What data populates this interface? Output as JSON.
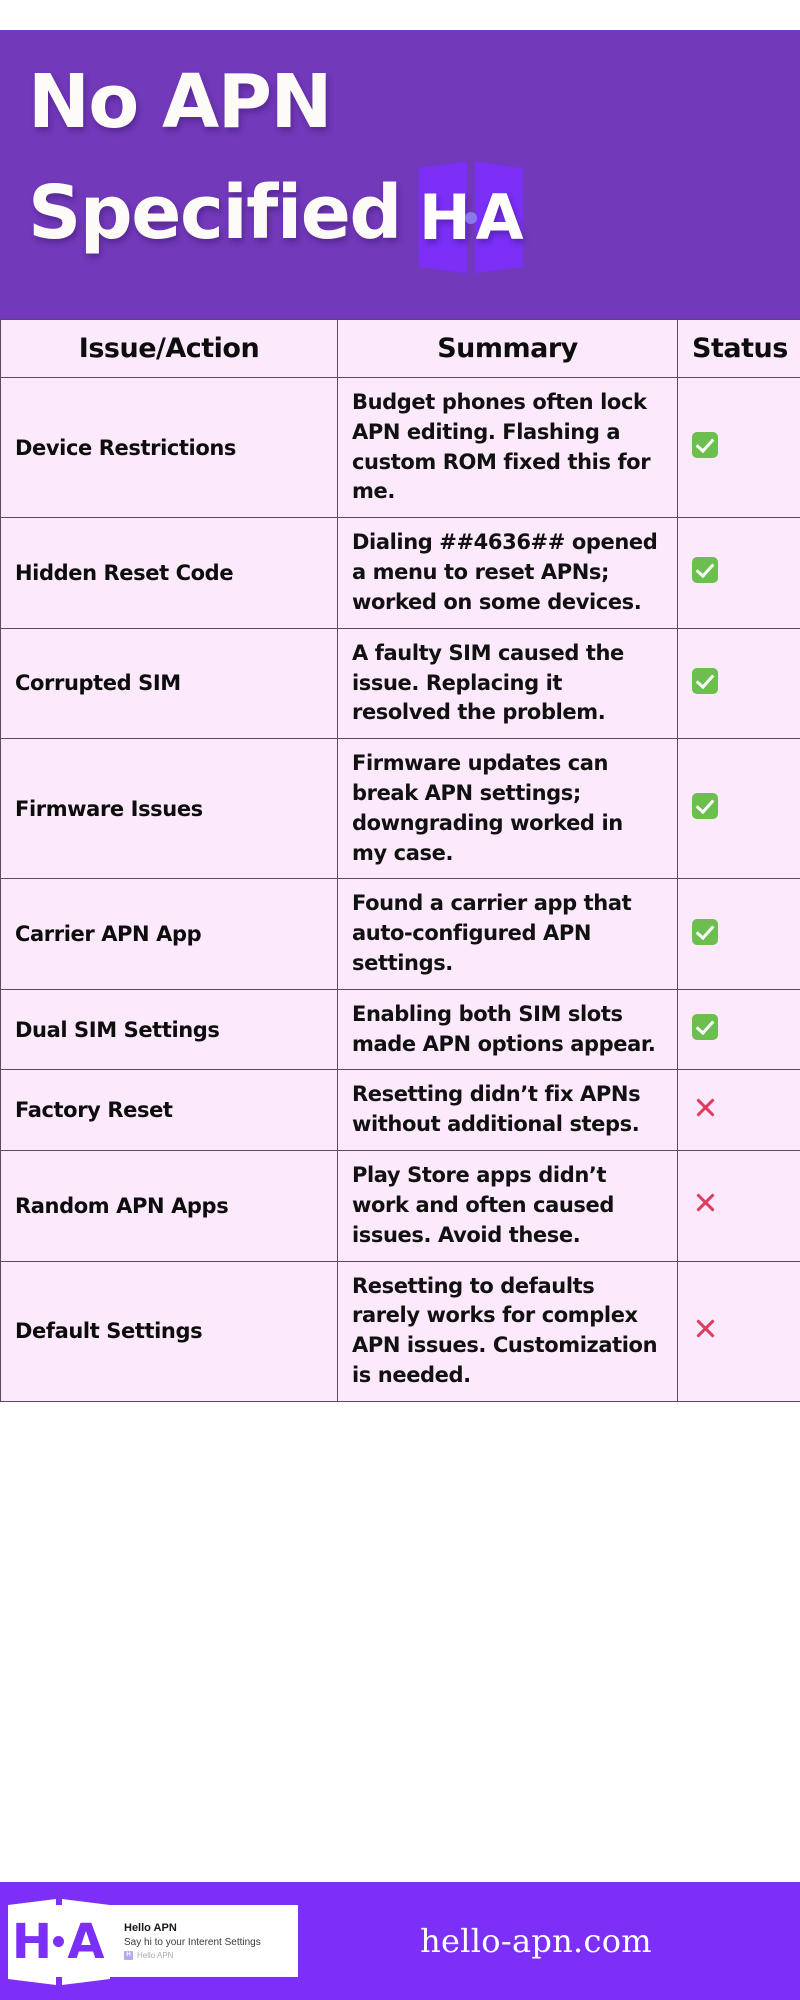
{
  "header": {
    "title_line1": "No APN",
    "title_line2": "Specified",
    "logo": {
      "left_letter": "H",
      "right_letter": "A",
      "name": "H·A"
    },
    "background_color": "#7239ba",
    "text_color": "#fdfbf8"
  },
  "table": {
    "columns": [
      "Issue/Action",
      "Summary",
      "Status"
    ],
    "rows": [
      {
        "issue": "Device Restrictions",
        "summary": "Budget phones often lock APN editing. Flashing a custom ROM fixed this for me.",
        "status": "yes"
      },
      {
        "issue": "Hidden Reset Code",
        "summary": "Dialing ##4636## opened a menu to reset APNs; worked on some devices.",
        "status": "yes"
      },
      {
        "issue": "Corrupted SIM",
        "summary": "A faulty SIM caused the issue. Replacing it resolved the problem.",
        "status": "yes"
      },
      {
        "issue": "Firmware Issues",
        "summary": "Firmware updates can break APN settings; downgrading worked in my case.",
        "status": "yes"
      },
      {
        "issue": "Carrier APN App",
        "summary": "Found a carrier app that auto-configured APN settings.",
        "status": "yes"
      },
      {
        "issue": "Dual SIM Settings",
        "summary": "Enabling both SIM slots made APN options appear.",
        "status": "yes"
      },
      {
        "issue": "Factory Reset",
        "summary": "Resetting didn’t fix APNs without additional steps.",
        "status": "no"
      },
      {
        "issue": "Random APN Apps",
        "summary": "Play Store apps didn’t work and often caused issues. Avoid these.",
        "status": "no"
      },
      {
        "issue": "Default Settings",
        "summary": "Resetting to defaults rarely works for complex APN issues. Customization is needed.",
        "status": "no"
      }
    ],
    "status_colors": {
      "yes": "#6cbe4e",
      "no": "#e03a5c"
    },
    "row_background": "#fce9fb",
    "border_color": "#5b4a63"
  },
  "footer": {
    "background_color": "#7b2ff7",
    "card": {
      "title": "Hello APN",
      "subtitle": "Say hi to your Interent Settings",
      "byline": "Hello  APN",
      "byline_badge": "H",
      "logo": {
        "left_letter": "H",
        "right_letter": "A"
      }
    },
    "url": "hello-apn.com"
  }
}
